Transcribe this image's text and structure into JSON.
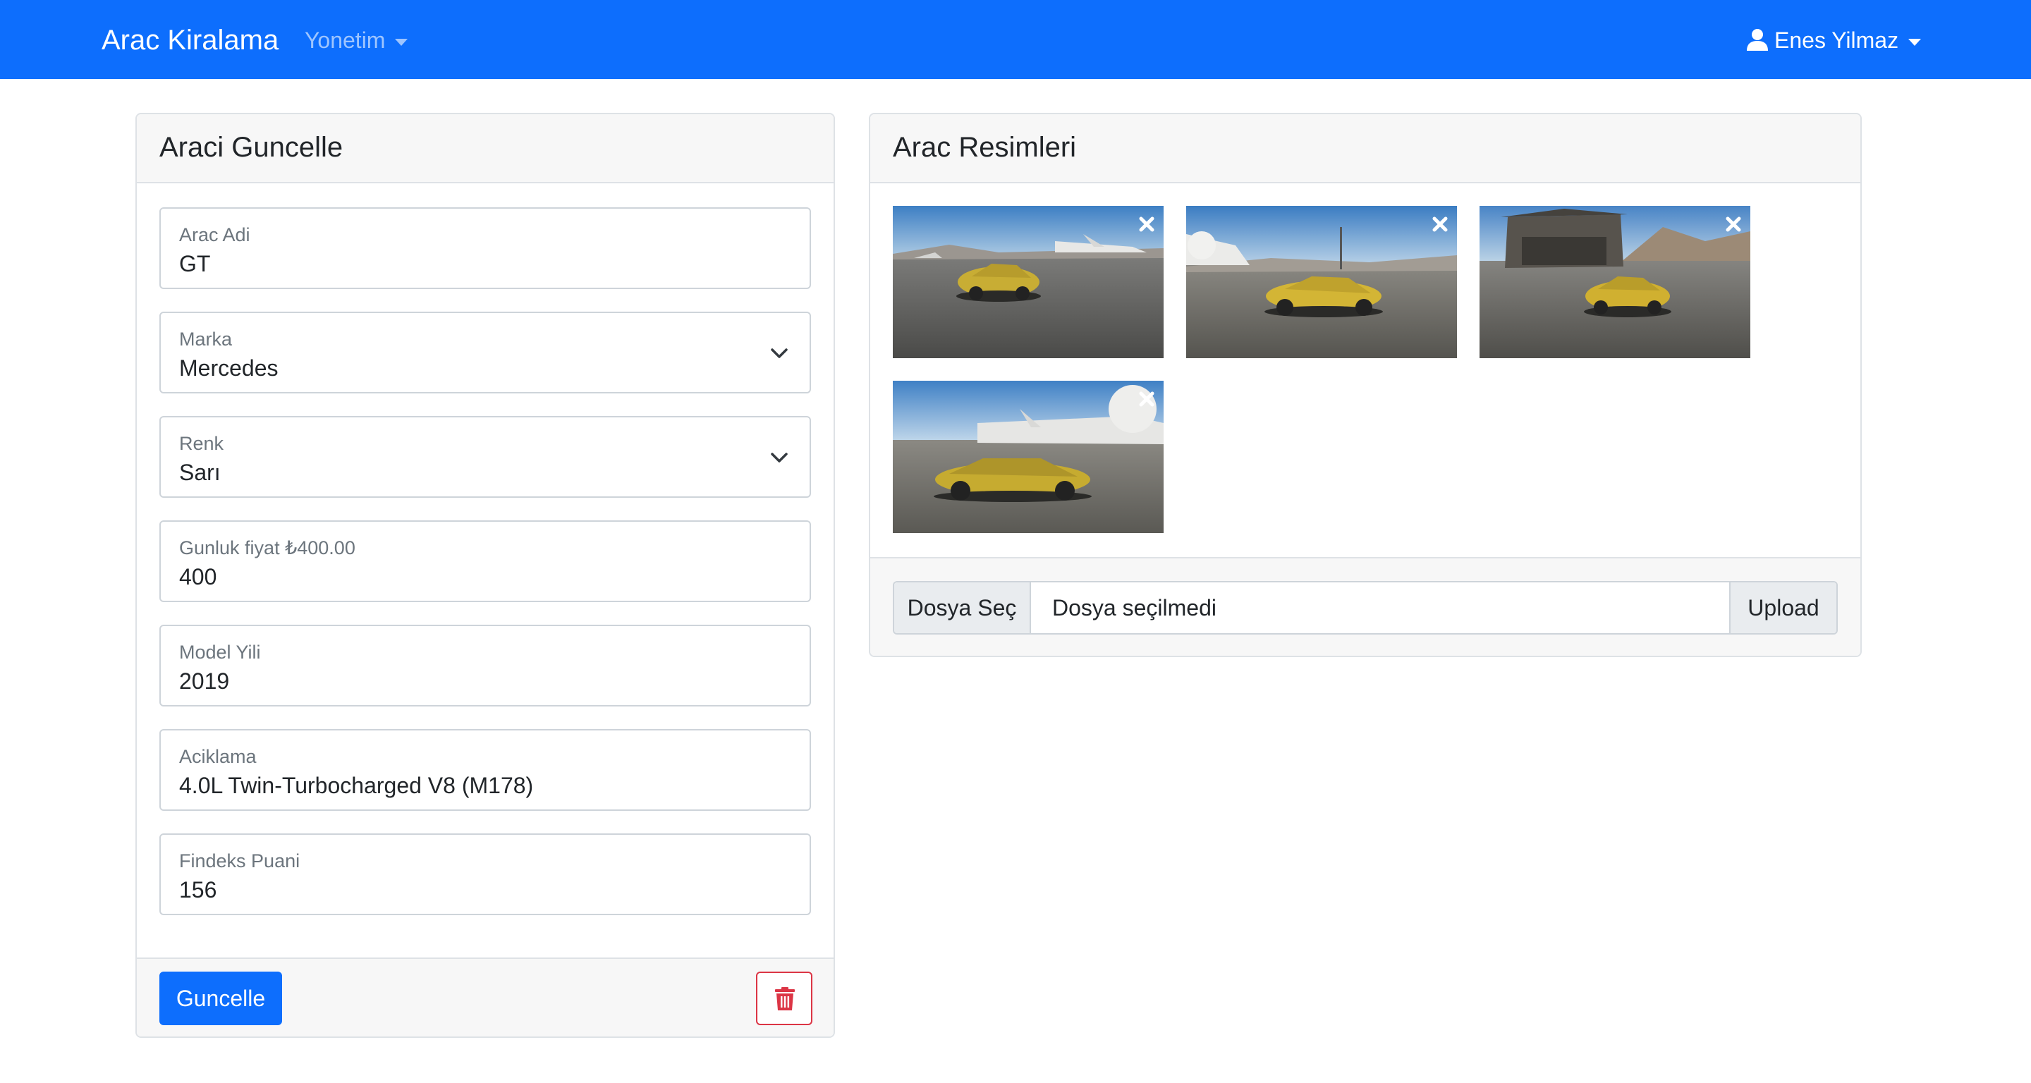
{
  "navbar": {
    "brand": "Arac Kiralama",
    "admin_menu": "Yonetim",
    "user_name": "Enes Yilmaz",
    "color": "#0d6efd"
  },
  "edit_card": {
    "title": "Araci Guncelle",
    "fields": [
      {
        "label": "Arac Adi",
        "value": "GT",
        "type": "input"
      },
      {
        "label": "Marka",
        "value": "Mercedes",
        "type": "select"
      },
      {
        "label": "Renk",
        "value": "Sarı",
        "type": "select"
      },
      {
        "label": "Gunluk fiyat ₺400.00",
        "value": "400",
        "type": "input"
      },
      {
        "label": "Model Yili",
        "value": "2019",
        "type": "input"
      },
      {
        "label": "Aciklama",
        "value": "4.0L Twin-Turbocharged V8 (M178)",
        "type": "input"
      },
      {
        "label": "Findeks Puani",
        "value": "156",
        "type": "input"
      }
    ],
    "update_button": "Guncelle",
    "delete_icon": "trash-icon",
    "danger_color": "#dc3545"
  },
  "images_card": {
    "title": "Arac Resimleri",
    "images": [
      {
        "name": "car-image-1",
        "remove_icon": "close-icon"
      },
      {
        "name": "car-image-2",
        "remove_icon": "close-icon"
      },
      {
        "name": "car-image-3",
        "remove_icon": "close-icon"
      },
      {
        "name": "car-image-4",
        "remove_icon": "close-icon"
      }
    ],
    "file_button": "Dosya Seç",
    "file_status": "Dosya seçilmedi",
    "upload_button": "Upload"
  }
}
